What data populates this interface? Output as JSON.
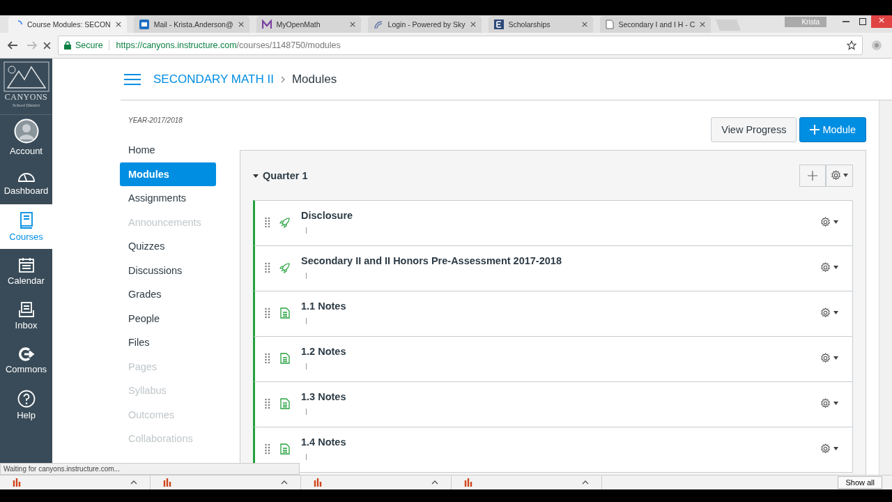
{
  "browser": {
    "tabs": [
      {
        "title": "Course Modules: SECON",
        "selected": true,
        "kind": "loading"
      },
      {
        "title": "Mail - Krista.Anderson@",
        "selected": false,
        "kind": "mail"
      },
      {
        "title": "MyOpenMath",
        "selected": false,
        "kind": "letter-m"
      },
      {
        "title": "Login - Powered by Sky",
        "selected": false,
        "kind": "arcs"
      },
      {
        "title": "Scholarships",
        "selected": false,
        "kind": "letter-e"
      },
      {
        "title": "Secondary I and I H - C",
        "selected": false,
        "kind": "document"
      }
    ],
    "profile": "Krista",
    "secure_label": "Secure",
    "url_host": "https://canyons.instructure.com",
    "url_path": "/courses/1148750/modules",
    "status": "Waiting for canyons.instructure.com...",
    "downloads": [
      {
        "kind": "pdf"
      },
      {
        "kind": "pdf"
      },
      {
        "kind": "pdf"
      },
      {
        "kind": "pdf"
      }
    ],
    "show_all": "Show all"
  },
  "global_nav": {
    "logo": {
      "name": "CANYONS",
      "subtitle": "School District"
    },
    "items": [
      {
        "label": "Account",
        "kind": "avatar",
        "selected": false
      },
      {
        "label": "Dashboard",
        "kind": "gauge",
        "selected": false
      },
      {
        "label": "Courses",
        "kind": "book",
        "selected": true
      },
      {
        "label": "Calendar",
        "kind": "calendar",
        "selected": false
      },
      {
        "label": "Inbox",
        "kind": "inbox",
        "selected": false
      },
      {
        "label": "Commons",
        "kind": "commons",
        "selected": false
      },
      {
        "label": "Help",
        "kind": "help",
        "selected": false
      }
    ]
  },
  "breadcrumb": [
    "SECONDARY MATH II",
    "Modules"
  ],
  "course_nav": {
    "term": "YEAR-2017/2018",
    "items": [
      {
        "label": "Home",
        "selected": false,
        "disabled": false
      },
      {
        "label": "Modules",
        "selected": true,
        "disabled": false
      },
      {
        "label": "Assignments",
        "selected": false,
        "disabled": false
      },
      {
        "label": "Announcements",
        "selected": false,
        "disabled": true
      },
      {
        "label": "Quizzes",
        "selected": false,
        "disabled": false
      },
      {
        "label": "Discussions",
        "selected": false,
        "disabled": false
      },
      {
        "label": "Grades",
        "selected": false,
        "disabled": false
      },
      {
        "label": "People",
        "selected": false,
        "disabled": false
      },
      {
        "label": "Files",
        "selected": false,
        "disabled": false
      },
      {
        "label": "Pages",
        "selected": false,
        "disabled": true
      },
      {
        "label": "Syllabus",
        "selected": false,
        "disabled": true
      },
      {
        "label": "Outcomes",
        "selected": false,
        "disabled": true
      },
      {
        "label": "Collaborations",
        "selected": false,
        "disabled": true
      }
    ]
  },
  "actions": {
    "view_progress": "View Progress",
    "add_module": "Module"
  },
  "module": {
    "title": "Quarter 1",
    "expanded": true,
    "items": [
      {
        "title": "Disclosure",
        "kind": "quiz"
      },
      {
        "title": "Secondary II and II Honors Pre-Assessment 2017-2018",
        "kind": "quiz"
      },
      {
        "title": "1.1 Notes",
        "kind": "page"
      },
      {
        "title": "1.2 Notes",
        "kind": "page"
      },
      {
        "title": "1.3 Notes",
        "kind": "page"
      },
      {
        "title": "1.4 Notes",
        "kind": "page"
      }
    ]
  }
}
